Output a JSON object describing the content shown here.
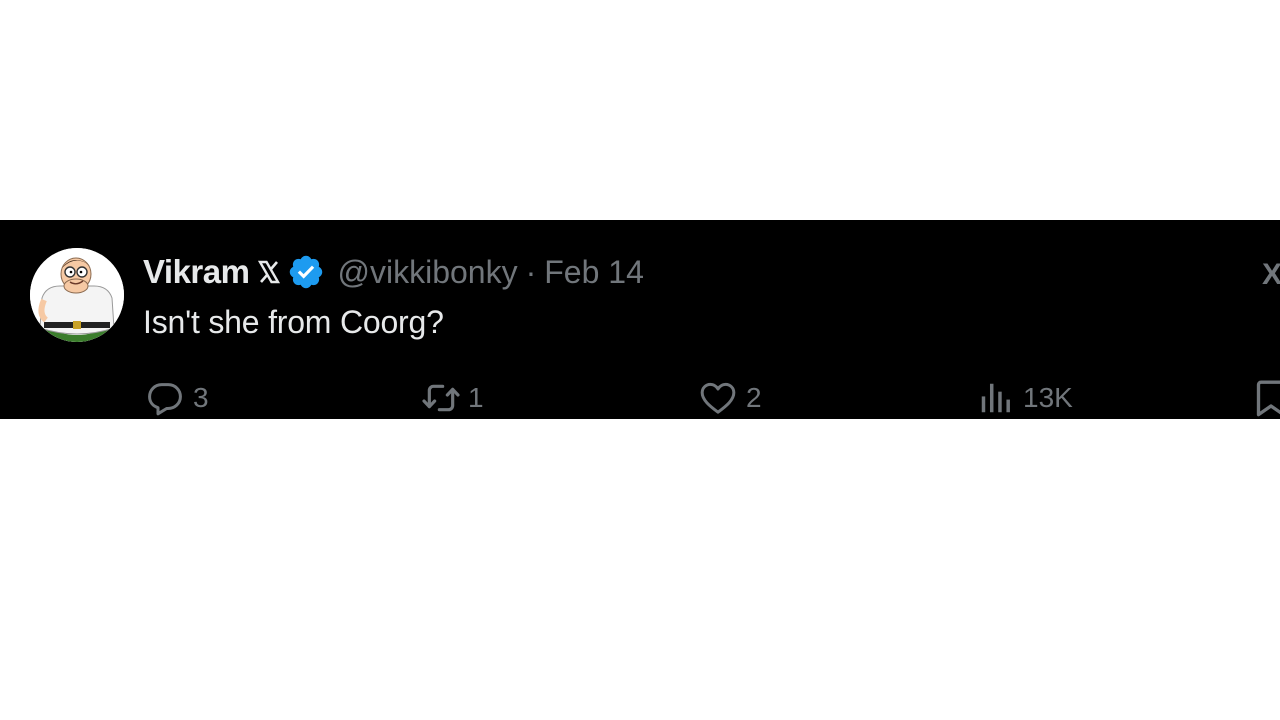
{
  "tweet": {
    "author": {
      "display_name": "Vikram",
      "name_badge": "𝕏",
      "handle": "@vikkibonky",
      "verified_color": "#1d9bf0",
      "avatar_icon": "peter-griffin-avatar"
    },
    "separator": "·",
    "date": "Feb 14",
    "text": "Isn't she from Coorg?",
    "more_label": "X",
    "actions": {
      "replies": {
        "icon": "reply-icon",
        "count": "3"
      },
      "retweets": {
        "icon": "retweet-icon",
        "count": "1"
      },
      "likes": {
        "icon": "heart-icon",
        "count": "2"
      },
      "views": {
        "icon": "analytics-icon",
        "count": "13K"
      },
      "bookmark": {
        "icon": "bookmark-icon"
      }
    }
  },
  "colors": {
    "background": "#000000",
    "primary_text": "#e7e9ea",
    "secondary_text": "#71767b",
    "accent": "#1d9bf0"
  }
}
